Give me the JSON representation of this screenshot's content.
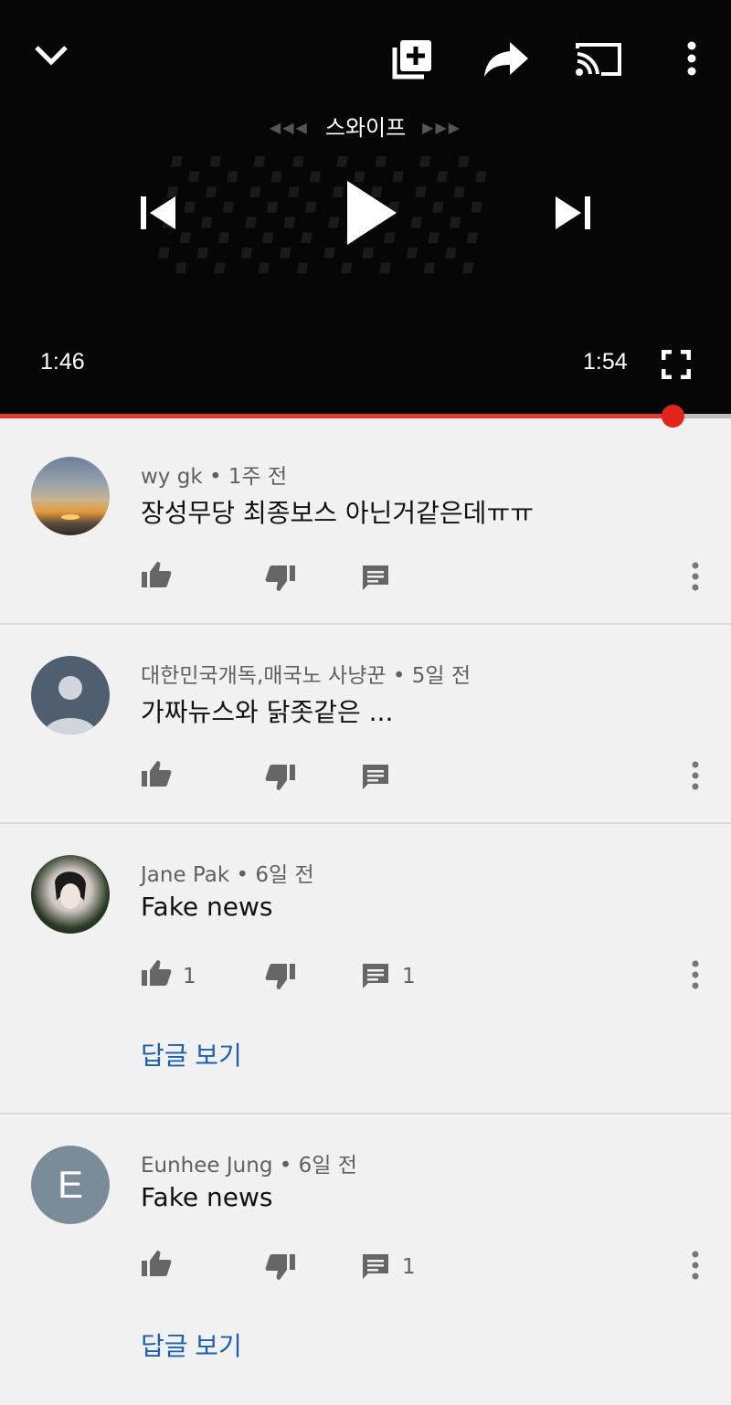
{
  "player": {
    "swipe_label": "스와이프",
    "current_time": "1:46",
    "duration": "1:54",
    "progress": 0.92,
    "accent_color": "#e3241b",
    "icons": [
      "chevron-down-icon",
      "add-to-playlist-icon",
      "share-icon",
      "cast-icon",
      "more-vert-icon",
      "previous-icon",
      "play-icon",
      "next-icon",
      "fullscreen-icon"
    ]
  },
  "comments": [
    {
      "author": "wy gk",
      "age": "1주 전",
      "text": "장성무당 최종보스 아닌거같은데ㅠㅠ",
      "likes": "",
      "replies_count": "",
      "show_replies": "",
      "avatar": "sunset"
    },
    {
      "author": "대한민국개독,매국노 사냥꾼",
      "age": "5일 전",
      "text": "가짜뉴스와 닭좃같은  ...",
      "likes": "",
      "replies_count": "",
      "show_replies": "",
      "avatar": "default"
    },
    {
      "author": "Jane Pak",
      "age": "6일 전",
      "text": "Fake news",
      "likes": "1",
      "replies_count": "1",
      "show_replies": "답글 보기",
      "avatar": "photo"
    },
    {
      "author": "Eunhee Jung",
      "age": "6일 전",
      "text": "Fake news",
      "likes": "",
      "replies_count": "1",
      "show_replies": "답글 보기",
      "avatar": "letter",
      "avatar_letter": "E"
    }
  ]
}
